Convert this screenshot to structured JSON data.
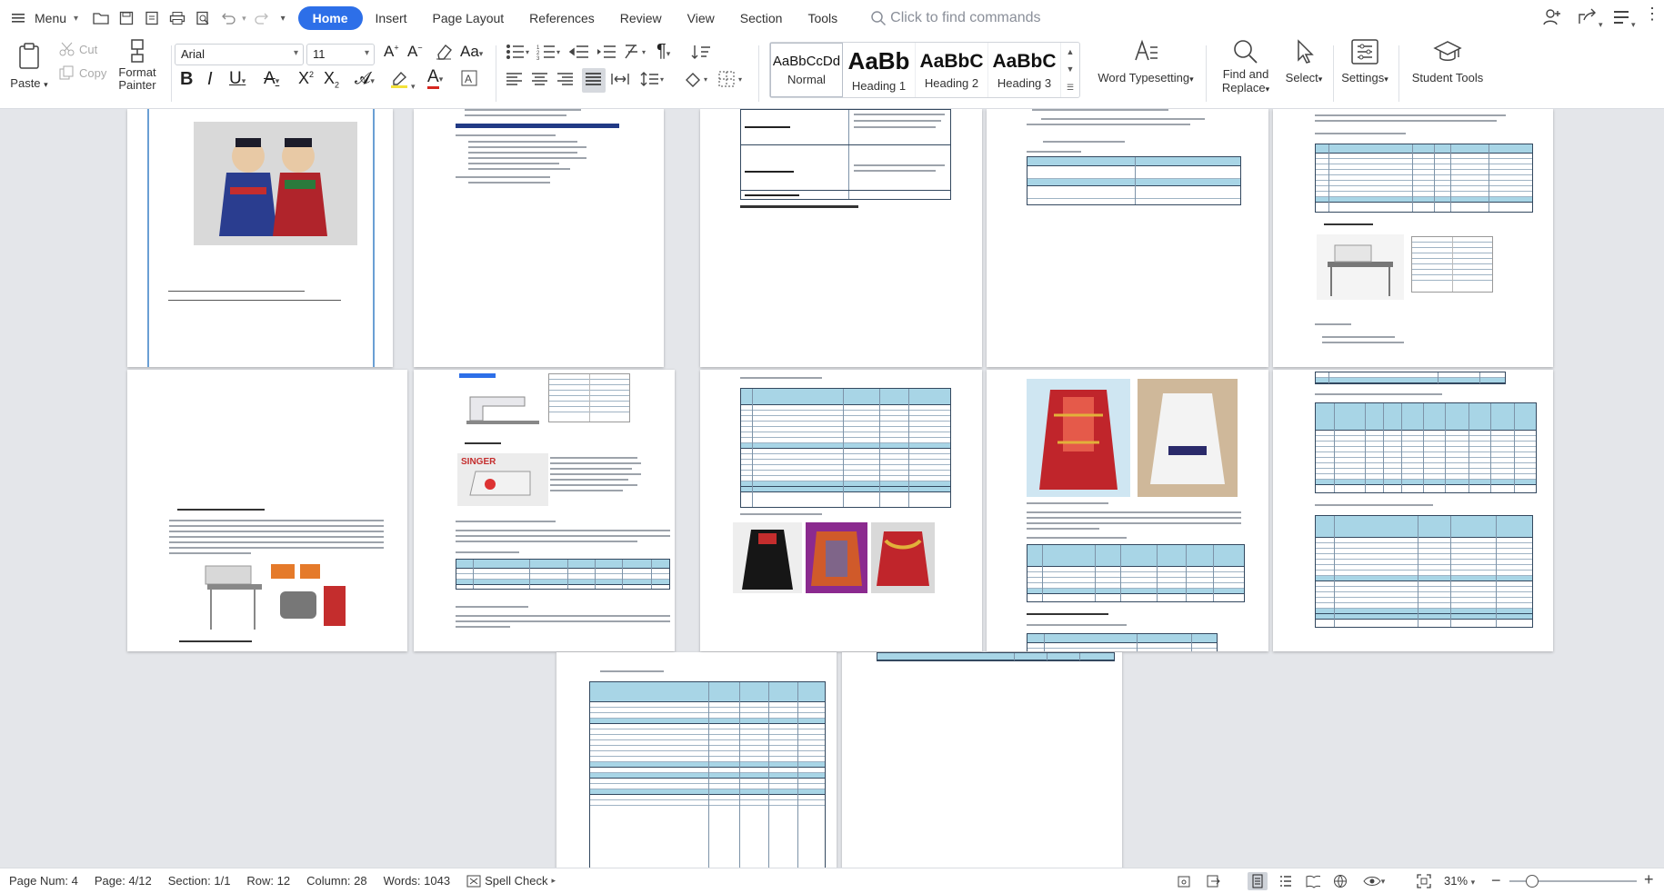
{
  "topbar": {
    "menu_label": "Menu",
    "tabs": [
      "Home",
      "Insert",
      "Page Layout",
      "References",
      "Review",
      "View",
      "Section",
      "Tools"
    ],
    "search_placeholder": "Click to find commands"
  },
  "ribbon": {
    "paste": "Paste",
    "cut": "Cut",
    "copy": "Copy",
    "format_painter_1": "Format",
    "format_painter_2": "Painter",
    "font_name": "Arial",
    "font_size": "11",
    "styles": [
      {
        "preview": "AaBbCcDd",
        "name": "Normal"
      },
      {
        "preview": "AaBb",
        "name": "Heading 1"
      },
      {
        "preview": "AaBbC",
        "name": "Heading 2"
      },
      {
        "preview": "AaBbC",
        "name": "Heading 3"
      }
    ],
    "word_typesetting": "Word Typesetting",
    "find_replace_1": "Find and",
    "find_replace_2": "Replace",
    "select": "Select",
    "settings": "Settings",
    "student_tools": "Student Tools"
  },
  "status": {
    "page_num": "Page Num: 4",
    "page": "Page: 4/12",
    "section": "Section: 1/1",
    "row": "Row: 12",
    "column": "Column: 28",
    "words": "Words: 1043",
    "spell_check": "Spell Check",
    "zoom": "31%"
  },
  "colors": {
    "accent": "#2d6fe8",
    "table_header": "#a8d5e6",
    "canvas": "#e4e6ea"
  }
}
